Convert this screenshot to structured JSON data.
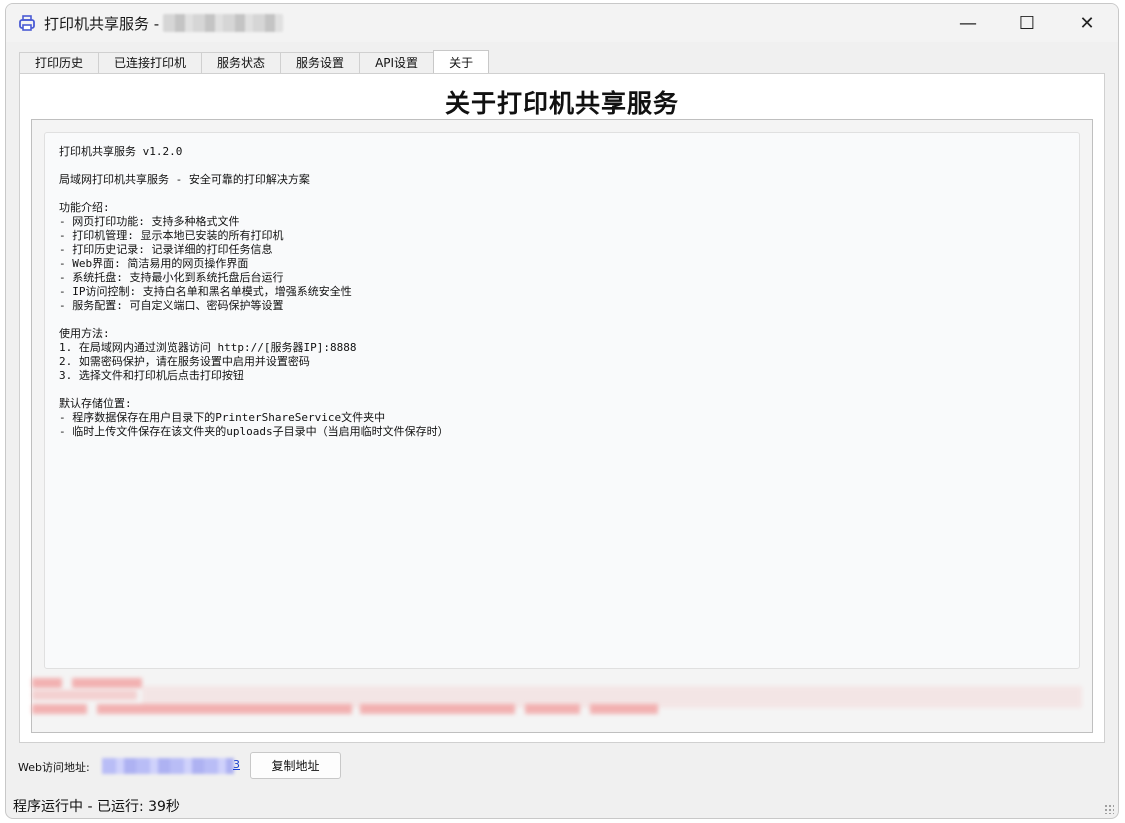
{
  "window": {
    "title": "打印机共享服务 -",
    "minimize_symbol": "—",
    "maximize_symbol": "☐",
    "close_symbol": "✕",
    "icon": "printer-icon"
  },
  "tabs": [
    {
      "label": "打印历史"
    },
    {
      "label": "已连接打印机"
    },
    {
      "label": "服务状态"
    },
    {
      "label": "服务设置"
    },
    {
      "label": "API设置"
    },
    {
      "label": "关于",
      "active": true
    }
  ],
  "about": {
    "heading": "关于打印机共享服务",
    "lines": [
      "打印机共享服务 v1.2.0",
      "",
      "局域网打印机共享服务 - 安全可靠的打印解决方案",
      "",
      "功能介绍:",
      "- 网页打印功能: 支持多种格式文件",
      "- 打印机管理: 显示本地已安装的所有打印机",
      "- 打印历史记录: 记录详细的打印任务信息",
      "- Web界面: 简洁易用的网页操作界面",
      "- 系统托盘: 支持最小化到系统托盘后台运行",
      "- IP访问控制: 支持白名单和黑名单模式，增强系统安全性",
      "- 服务配置: 可自定义端口、密码保护等设置",
      "",
      "使用方法:",
      "1. 在局域网内通过浏览器访问 http://[服务器IP]:8888",
      "2. 如需密码保护，请在服务设置中启用并设置密码",
      "3. 选择文件和打印机后点击打印按钮",
      "",
      "默认存储位置:",
      "- 程序数据保存在用户目录下的PrinterShareService文件夹中",
      "- 临时上传文件保存在该文件夹的uploads子目录中（当启用临时文件保存时）"
    ]
  },
  "web_access": {
    "label": "Web访问地址:",
    "link_visible_tail": "3",
    "copy_button": "复制地址"
  },
  "status": {
    "text": "程序运行中 - 已运行: 39秒"
  }
}
